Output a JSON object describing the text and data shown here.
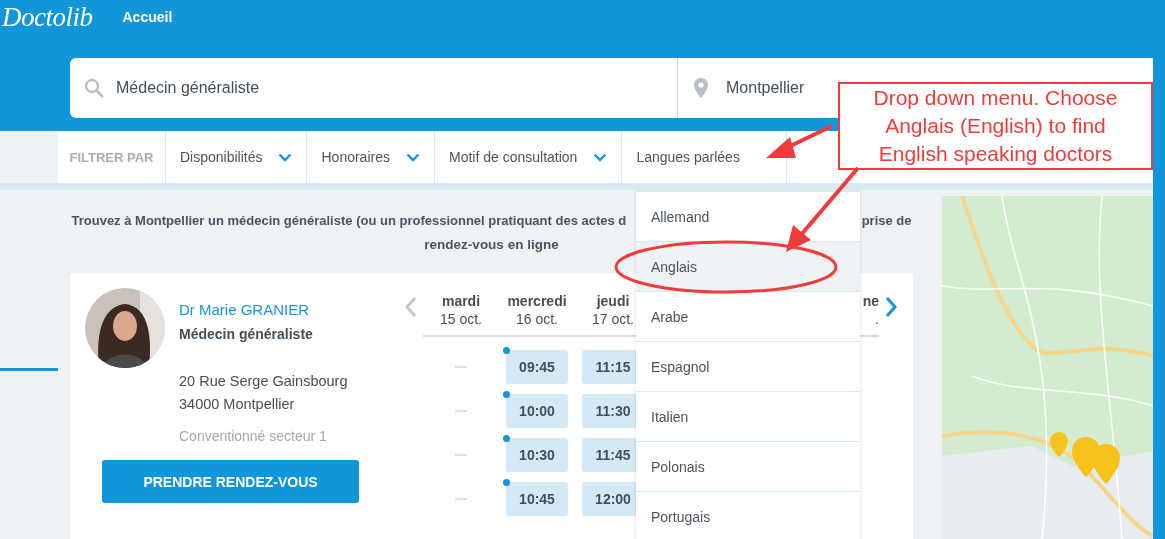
{
  "header": {
    "logo": "Doctolib",
    "nav_link": "Accueil"
  },
  "search": {
    "specialty": "Médecin généraliste",
    "location": "Montpellier"
  },
  "filters": {
    "label": "FILTRER PAR",
    "items": [
      {
        "label": "Disponibilités"
      },
      {
        "label": "Honoraires"
      },
      {
        "label": "Motif de consultation"
      },
      {
        "label": "Langues parlées"
      }
    ]
  },
  "intro": {
    "line_1_start": "Trouvez à Montpellier un médecin généraliste (ou un professionnel pratiquant des actes d",
    "line_1_end": "prise de",
    "line_2": "rendez-vous en ligne"
  },
  "doctor": {
    "name": "Dr Marie GRANIER",
    "specialty": "Médecin généraliste",
    "address": [
      "20 Rue Serge Gainsbourg",
      "34000 Montpellier"
    ],
    "sector": "Conventionné secteur 1",
    "book_button": "PRENDRE RENDEZ-VOUS"
  },
  "calendar": {
    "days": [
      {
        "day": "mardi",
        "date": "15 oct.",
        "slots": [
          {
            "kind": "none"
          },
          {
            "kind": "none"
          },
          {
            "kind": "none"
          },
          {
            "kind": "none"
          }
        ]
      },
      {
        "day": "mercredi",
        "date": "16 oct.",
        "slots": [
          {
            "kind": "time",
            "time": "09:45",
            "marked": true
          },
          {
            "kind": "time",
            "time": "10:00",
            "marked": true
          },
          {
            "kind": "time",
            "time": "10:30",
            "marked": true
          },
          {
            "kind": "time",
            "time": "10:45",
            "marked": true
          }
        ]
      },
      {
        "day": "jeudi",
        "date": "17 oct.",
        "slots": [
          {
            "kind": "time",
            "time": "11:15",
            "marked": false
          },
          {
            "kind": "time",
            "time": "11:30",
            "marked": false
          },
          {
            "kind": "time",
            "time": "11:45",
            "marked": false
          },
          {
            "kind": "time",
            "time": "12:00",
            "marked": false
          }
        ]
      },
      {
        "day": "ne",
        "date": "."
      }
    ]
  },
  "language_menu": {
    "items": [
      {
        "label": "Allemand",
        "selected": false
      },
      {
        "label": "Anglais",
        "selected": true
      },
      {
        "label": "Arabe",
        "selected": false
      },
      {
        "label": "Espagnol",
        "selected": false
      },
      {
        "label": "Italien",
        "selected": false
      },
      {
        "label": "Polonais",
        "selected": false
      },
      {
        "label": "Portugais",
        "selected": false
      }
    ]
  },
  "annotation": {
    "text": "Drop down menu. Choose Anglais (English) to find English speaking doctors"
  }
}
